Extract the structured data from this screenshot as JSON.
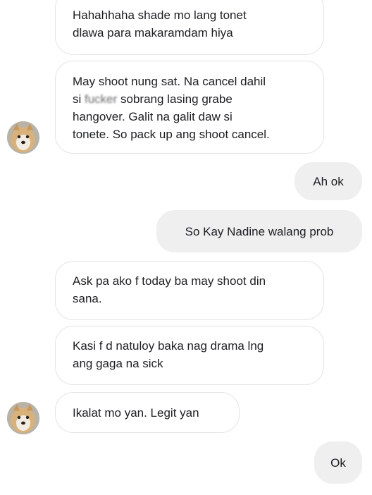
{
  "messages": [
    {
      "id": "m1",
      "side": "incoming",
      "lines": [
        "Hahahhaha shade mo lang tonet",
        "dlawa para makaramdam hiya"
      ]
    },
    {
      "id": "m2",
      "side": "incoming",
      "lines": [
        "May shoot nung sat. Na cancel dahil",
        "si ",
        "fucker",
        " sobrang lasing grabe",
        "hangover. Galit na galit daw si",
        "tonete. So pack up ang shoot cancel."
      ]
    },
    {
      "id": "m3",
      "side": "outgoing",
      "text": "Ah ok"
    },
    {
      "id": "m4",
      "side": "outgoing",
      "text": "So Kay Nadine walang prob"
    },
    {
      "id": "m5",
      "side": "incoming",
      "lines": [
        "Ask pa ako f today ba may shoot din",
        "sana."
      ]
    },
    {
      "id": "m6",
      "side": "incoming",
      "lines": [
        "Kasi f d natuloy baka nag drama lng",
        "ang gaga na sick"
      ]
    },
    {
      "id": "m7",
      "side": "incoming",
      "text": "Ikalat mo yan. Legit yan"
    },
    {
      "id": "m8",
      "side": "outgoing",
      "text": "Ok"
    }
  ],
  "avatar": {
    "icon": "dog-avatar-icon",
    "colors": {
      "fur": "#d8b27a",
      "face": "#f2ece2",
      "bg": "#b9b2a6"
    }
  },
  "colors": {
    "incoming_border": "#e2e4e7",
    "outgoing_bg": "#efefef",
    "text": "#1c1e21"
  }
}
